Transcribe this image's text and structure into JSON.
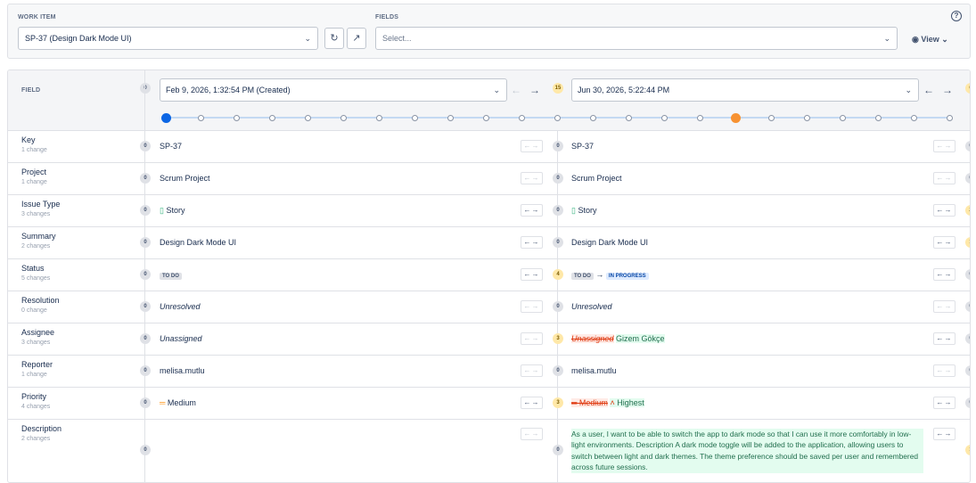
{
  "top": {
    "work_item_label": "WORK ITEM",
    "work_item_value": "SP-37 (Design Dark Mode UI)",
    "fields_label": "FIELDS",
    "fields_placeholder": "Select...",
    "view_label": "View",
    "help_icon": "?"
  },
  "header": {
    "field_label": "FIELD",
    "left_badge": "0",
    "left_select": "Feb 9, 2026, 1:32:54 PM (Created)",
    "mid_badge": "15",
    "right_select": "Jun 30, 2026, 5:22:44 PM",
    "right_badge": "6"
  },
  "timeline": {
    "total_points": 23,
    "left_index": 0,
    "right_index": 16,
    "left_color": "#0c66e4",
    "right_color": "#f79232"
  },
  "rows": [
    {
      "name": "Key",
      "changes": "1 change",
      "lb": "0",
      "left": "SP-37",
      "mb": "0",
      "right": "SP-37",
      "rb": "0"
    },
    {
      "name": "Project",
      "changes": "1 change",
      "lb": "0",
      "left": "Scrum Project",
      "mb": "0",
      "right": "Scrum Project",
      "rb": "0"
    },
    {
      "name": "Issue Type",
      "changes": "3 changes",
      "lb": "0",
      "left": "Story",
      "mb": "0",
      "right": "Story",
      "rb": "2"
    },
    {
      "name": "Summary",
      "changes": "2 changes",
      "lb": "0",
      "left": "Design Dark Mode UI",
      "mb": "0",
      "right": "Design Dark Mode UI",
      "rb": "1"
    },
    {
      "name": "Status",
      "changes": "5 changes",
      "lb": "0",
      "left": "TO DO",
      "mb": "4",
      "right_from": "TO DO",
      "right_to": "IN PROGRESS",
      "rb": "0"
    },
    {
      "name": "Resolution",
      "changes": "0 change",
      "lb": "0",
      "left": "Unresolved",
      "mb": "0",
      "right": "Unresolved",
      "rb": "0"
    },
    {
      "name": "Assignee",
      "changes": "3 changes",
      "lb": "0",
      "left": "Unassigned",
      "mb": "3",
      "right_old": "Unassigned",
      "right_new": "Gizem Gökçe",
      "rb": "0"
    },
    {
      "name": "Reporter",
      "changes": "1 change",
      "lb": "0",
      "left": "melisa.mutlu",
      "mb": "0",
      "right": "melisa.mutlu",
      "rb": "0"
    },
    {
      "name": "Priority",
      "changes": "4 changes",
      "lb": "0",
      "left": "Medium",
      "mb": "3",
      "right_old": "Medium",
      "right_new": "Highest",
      "rb": "0"
    },
    {
      "name": "Description",
      "changes": "2 changes",
      "lb": "0",
      "left": "",
      "mb": "0",
      "right": "As a user, I want to be able to switch the app to dark mode so that I can use it more comfortably in low-light environments. Description A dark mode toggle will be added to the application, allowing users to switch between light and dark themes. The theme preference should be saved per user and remembered across future sessions.",
      "rb": "1"
    }
  ],
  "icons": {
    "refresh": "refresh-icon",
    "external": "external-link-icon",
    "eye": "eye-icon",
    "story": "bookmark-icon",
    "medium": "priority-medium-icon",
    "highest": "priority-highest-icon"
  },
  "colors": {
    "strike_red": "#de350b",
    "add_green": "#216e4e",
    "badge_yellow": "#ffe8a8",
    "track_blue": "#c4d9f2"
  }
}
